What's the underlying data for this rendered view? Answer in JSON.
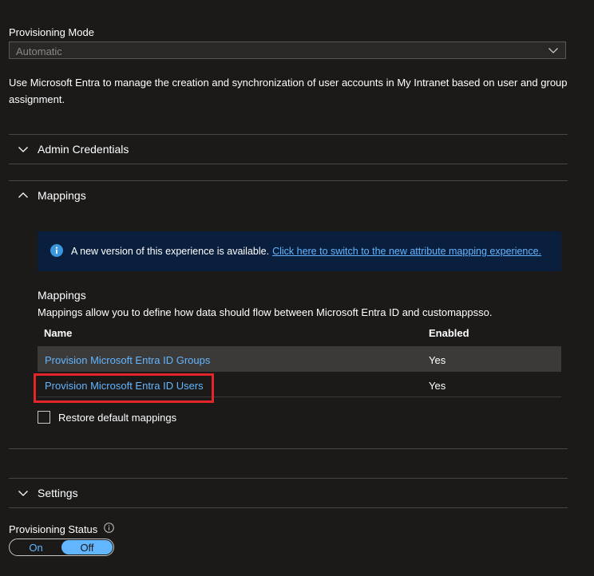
{
  "provisioning_mode": {
    "label": "Provisioning Mode",
    "selected": "Automatic"
  },
  "description": "Use Microsoft Entra to manage the creation and synchronization of user accounts in My Intranet based on user and group assignment.",
  "sections": {
    "admin_credentials": "Admin Credentials",
    "mappings": "Mappings",
    "settings": "Settings"
  },
  "banner": {
    "text": "A new version of this experience is available.",
    "link": "Click here to switch to the new attribute mapping experience."
  },
  "mappings": {
    "title": "Mappings",
    "description": "Mappings allow you to define how data should flow between Microsoft Entra ID and customappsso.",
    "columns": [
      "Name",
      "Enabled"
    ],
    "rows": [
      {
        "name": "Provision Microsoft Entra ID Groups",
        "enabled": "Yes"
      },
      {
        "name": "Provision Microsoft Entra ID Users",
        "enabled": "Yes"
      }
    ],
    "restore_label": "Restore default mappings"
  },
  "provisioning_status": {
    "label": "Provisioning Status",
    "on_label": "On",
    "off_label": "Off",
    "selected": "Off"
  },
  "colors": {
    "background": "#1b1a19",
    "link": "#62b5ff",
    "banner_bg": "#0a1f3d",
    "highlight": "#e3262b",
    "row_alt": "#3b3a39"
  }
}
